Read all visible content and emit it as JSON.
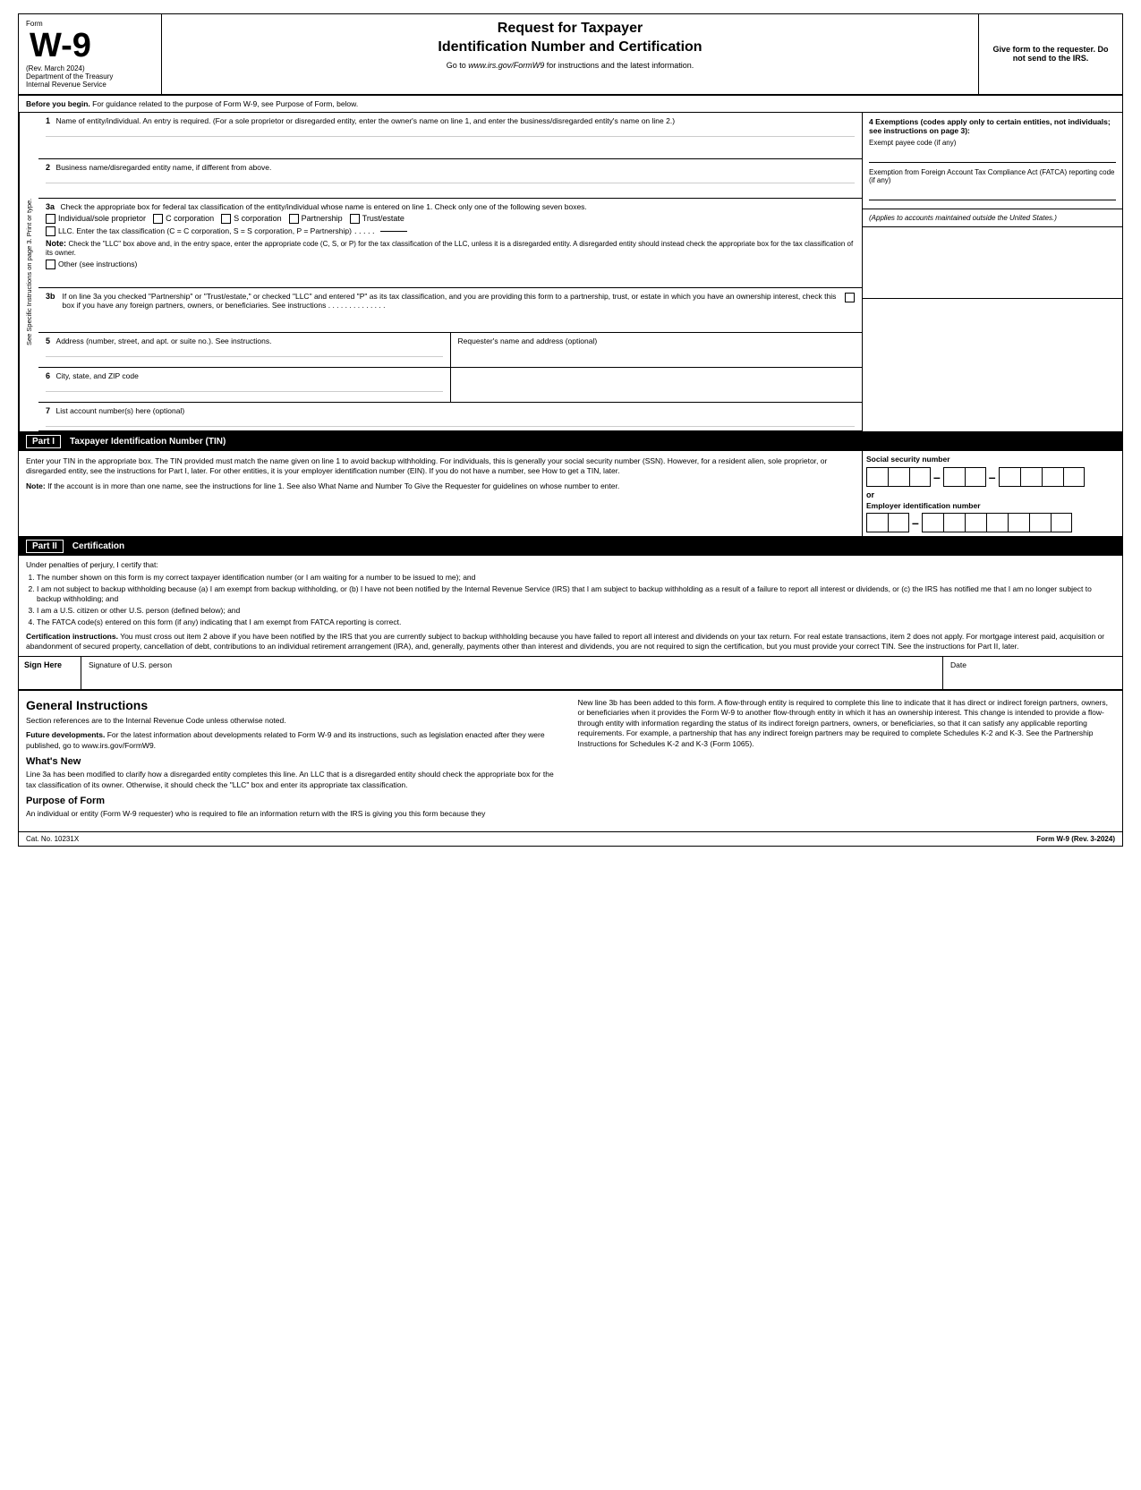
{
  "header": {
    "form_label": "Form",
    "form_number": "W-9",
    "rev_date": "(Rev. March 2024)",
    "dept": "Department of the Treasury",
    "service": "Internal Revenue Service",
    "title_line1": "Request for Taxpayer",
    "title_line2": "Identification Number and Certification",
    "website_text": "Go to www.irs.gov/FormW9 for instructions and the latest information.",
    "give_form": "Give form to the requester. Do not send to the IRS."
  },
  "before_begin": {
    "label": "Before you begin.",
    "text": "For guidance related to the purpose of Form W-9, see Purpose of Form, below."
  },
  "fields": {
    "field1_number": "1",
    "field1_label": "Name of entity/individual. An entry is required. (For a sole proprietor or disregarded entity, enter the owner's name on line 1, and enter the business/disregarded entity's name on line 2.)",
    "field2_number": "2",
    "field2_label": "Business name/disregarded entity name, if different from above.",
    "field3a_number": "3a",
    "field3a_label": "Check the appropriate box for federal tax classification of the entity/individual whose name is entered on line 1. Check only one of the following seven boxes.",
    "checkbox_individual": "Individual/sole proprietor",
    "checkbox_c_corp": "C corporation",
    "checkbox_s_corp": "S corporation",
    "checkbox_partnership": "Partnership",
    "checkbox_trust": "Trust/estate",
    "checkbox_llc": "LLC. Enter the tax classification (C = C corporation, S = S corporation, P = Partnership)",
    "llc_dots": ". . . . .",
    "note_label": "Note:",
    "note_text": "Check the \"LLC\" box above and, in the entry space, enter the appropriate code (C, S, or P) for the tax classification of the LLC, unless it is a disregarded entity. A disregarded entity should instead check the appropriate box for the tax classification of its owner.",
    "checkbox_other": "Other (see instructions)",
    "field3b_number": "3b",
    "field3b_text": "If on line 3a you checked \"Partnership\" or \"Trust/estate,\" or checked \"LLC\" and entered \"P\" as its tax classification, and you are providing this form to a partnership, trust, or estate in which you have an ownership interest, check this box if you have any foreign partners, owners, or beneficiaries. See instructions",
    "field3b_dots": ". . . . . . . . . . . . . .",
    "field4_label": "4 Exemptions (codes apply only to certain entities, not individuals; see instructions on page 3):",
    "exempt_payee": "Exempt payee code (if any)",
    "fatca_label": "Exemption from Foreign Account Tax Compliance Act (FATCA) reporting code (if any)",
    "applies_label": "(Applies to accounts maintained outside the United States.)",
    "field5_number": "5",
    "field5_label": "Address (number, street, and apt. or suite no.). See instructions.",
    "requester_label": "Requester's name and address (optional)",
    "field6_number": "6",
    "field6_label": "City, state, and ZIP code",
    "field7_number": "7",
    "field7_label": "List account number(s) here (optional)"
  },
  "side_label": "See Specific Instructions on page 3. Print or type.",
  "part1": {
    "label": "Part I",
    "title": "Taxpayer Identification Number (TIN)",
    "intro": "Enter your TIN in the appropriate box. The TIN provided must match the name given on line 1 to avoid backup withholding. For individuals, this is generally your social security number (SSN). However, for a resident alien, sole proprietor, or disregarded entity, see the instructions for Part I, later. For other entities, it is your employer identification number (EIN). If you do not have a number, see How to get a TIN, later.",
    "note_label": "Note:",
    "note_text": "If the account is in more than one name, see the instructions for line 1. See also What Name and Number To Give the Requester for guidelines on whose number to enter.",
    "ssn_label": "Social security number",
    "or_text": "or",
    "ein_label": "Employer identification number"
  },
  "part2": {
    "label": "Part II",
    "title": "Certification",
    "intro": "Under penalties of perjury, I certify that:",
    "items": [
      "The number shown on this form is my correct taxpayer identification number (or I am waiting for a number to be issued to me); and",
      "I am not subject to backup withholding because (a) I am exempt from backup withholding, or (b) I have not been notified by the Internal Revenue Service (IRS) that I am subject to backup withholding as a result of a failure to report all interest or dividends, or (c) the IRS has notified me that I am no longer subject to backup withholding; and",
      "I am a U.S. citizen or other U.S. person (defined below); and",
      "The FATCA code(s) entered on this form (if any) indicating that I am exempt from FATCA reporting is correct."
    ],
    "cert_instructions_label": "Certification instructions.",
    "cert_instructions_text": "You must cross out item 2 above if you have been notified by the IRS that you are currently subject to backup withholding because you have failed to report all interest and dividends on your tax return. For real estate transactions, item 2 does not apply. For mortgage interest paid, acquisition or abandonment of secured property, cancellation of debt, contributions to an individual retirement arrangement (IRA), and, generally, payments other than interest and dividends, you are not required to sign the certification, but you must provide your correct TIN. See the instructions for Part II, later."
  },
  "sign": {
    "sign_here_label": "Sign Here",
    "signature_label": "Signature of U.S. person",
    "date_label": "Date"
  },
  "general_instructions": {
    "title": "General Instructions",
    "para1": "Section references are to the Internal Revenue Code unless otherwise noted.",
    "future_label": "Future developments.",
    "future_text": "For the latest information about developments related to Form W-9 and its instructions, such as legislation enacted after they were published, go to www.irs.gov/FormW9.",
    "whats_new_title": "What's New",
    "whats_new_text": "Line 3a has been modified to clarify how a disregarded entity completes this line. An LLC that is a disregarded entity should check the appropriate box for the tax classification of its owner. Otherwise, it should check the \"LLC\" box and enter its appropriate tax classification.",
    "purpose_title": "Purpose of Form",
    "purpose_text": "An individual or entity (Form W-9 requester) who is required to file an information return with the IRS is giving you this form because they"
  },
  "right_general": {
    "new_line_3b_text": "New line 3b has been added to this form. A flow-through entity is required to complete this line to indicate that it has direct or indirect foreign partners, owners, or beneficiaries when it provides the Form W-9 to another flow-through entity in which it has an ownership interest. This change is intended to provide a flow-through entity with information regarding the status of its indirect foreign partners, owners, or beneficiaries, so that it can satisfy any applicable reporting requirements. For example, a partnership that has any indirect foreign partners may be required to complete Schedules K-2 and K-3. See the Partnership Instructions for Schedules K-2 and K-3 (Form 1065)."
  },
  "footer": {
    "cat_no": "Cat. No. 10231X",
    "form_label": "Form W-9 (Rev. 3-2024)"
  }
}
